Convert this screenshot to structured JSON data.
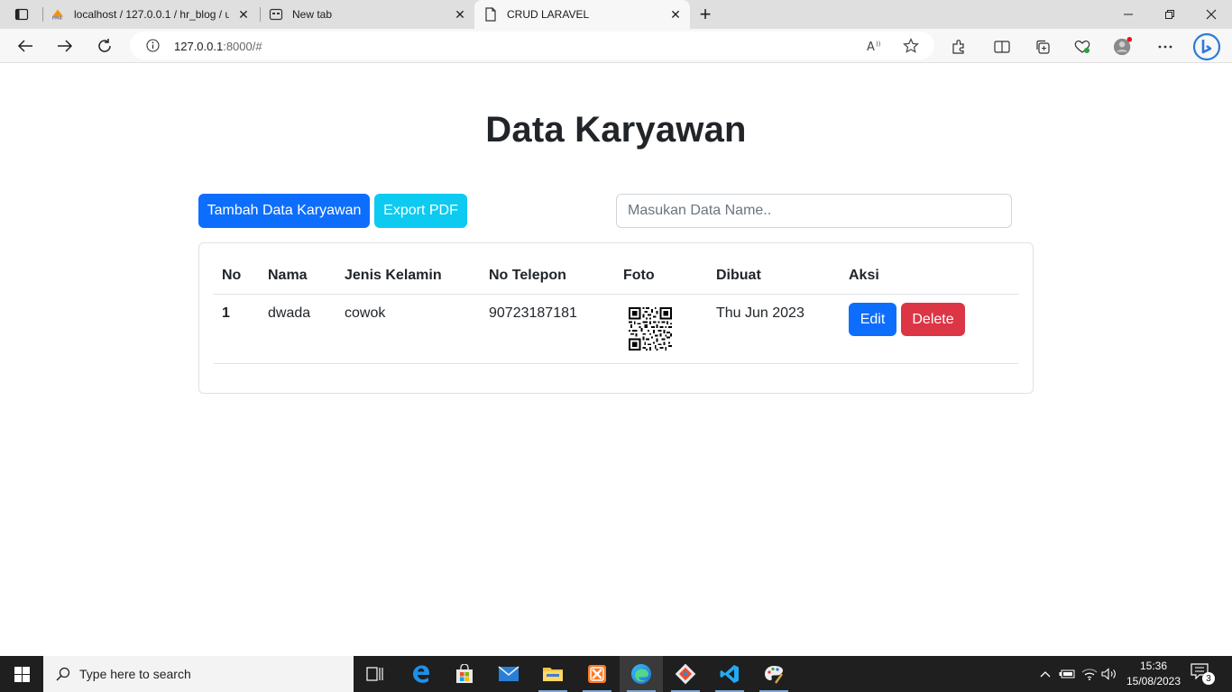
{
  "browser": {
    "tabs": [
      {
        "title": "localhost / 127.0.0.1 / hr_blog / u",
        "icon": "phpmyadmin-icon"
      },
      {
        "title": "New tab",
        "icon": "newtab-icon"
      },
      {
        "title": "CRUD LARAVEL",
        "icon": "page-icon",
        "active": true
      }
    ],
    "url_host": "127.0.0.1",
    "url_rest": ":8000/#"
  },
  "page": {
    "title": "Data Karyawan",
    "add_button": "Tambah Data Karyawan",
    "export_button": "Export PDF",
    "search_placeholder": "Masukan Data Name..",
    "table": {
      "headers": [
        "No",
        "Nama",
        "Jenis Kelamin",
        "No Telepon",
        "Foto",
        "Dibuat",
        "Aksi"
      ],
      "rows": [
        {
          "no": "1",
          "nama": "dwada",
          "jenis_kelamin": "cowok",
          "no_telepon": "90723187181",
          "foto": "qr-code-image",
          "dibuat": "Thu Jun 2023",
          "edit": "Edit",
          "delete": "Delete"
        }
      ]
    }
  },
  "colors": {
    "primary": "#0d6efd",
    "info": "#0dcaf0",
    "danger": "#dc3545"
  },
  "taskbar": {
    "search_placeholder": "Type here to search",
    "time": "15:36",
    "date": "15/08/2023",
    "notification_count": "3"
  }
}
